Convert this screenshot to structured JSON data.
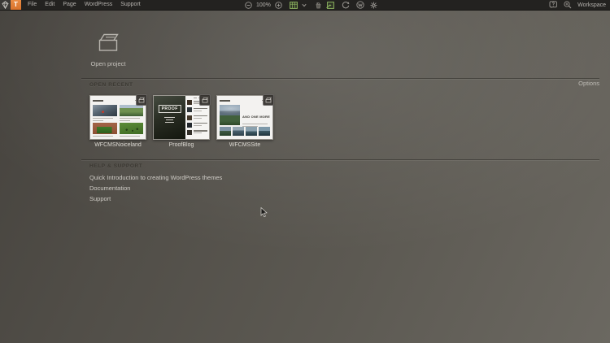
{
  "window": {
    "app_icon_letter": "T",
    "menus": [
      {
        "label": "File"
      },
      {
        "label": "Edit"
      },
      {
        "label": "Page"
      },
      {
        "label": "WordPress"
      },
      {
        "label": "Support"
      }
    ],
    "zoom_level": "100%",
    "workspace_label": "Workspace"
  },
  "start_screen": {
    "open_project_label": "Open project",
    "recent": {
      "heading": "OPEN RECENT",
      "options_label": "Options",
      "projects": [
        {
          "name": "WFCMSNoiceland"
        },
        {
          "name": "ProofBlog",
          "logo_text": "PROOF"
        },
        {
          "name": "WFCMSSite",
          "headline": "AND ONE MORE"
        }
      ]
    },
    "help": {
      "heading": "HELP & SUPPORT",
      "links": [
        {
          "label": "Quick Introduction to creating WordPress themes"
        },
        {
          "label": "Documentation"
        },
        {
          "label": "Support"
        }
      ]
    }
  },
  "colors": {
    "topbar_bg": "#232220",
    "accent_green": "#8cb35f",
    "app_icon_orange": "#e0813a",
    "workspace_light": "#6b6861",
    "workspace_dark": "#45423d",
    "heading_text": "#3b3832",
    "link_text": "#cfccc6"
  }
}
